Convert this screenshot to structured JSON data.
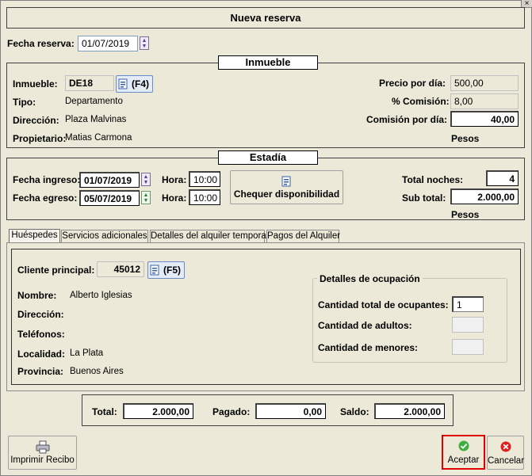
{
  "window": {
    "title": "Nueva reserva",
    "close_glyph": "×",
    "fecha_reserva_label": "Fecha reserva:",
    "fecha_reserva_value": "01/07/2019"
  },
  "inmueble": {
    "section_title": "Inmueble",
    "inmueble_label": "Inmueble:",
    "inmueble_value": "DE18",
    "pick_label": "(F4)",
    "tipo_label": "Tipo:",
    "tipo_value": "Departamento",
    "direccion_label": "Dirección:",
    "direccion_value": "Plaza Malvinas",
    "propietario_label": "Propietario:",
    "propietario_value": "Matias Carmona",
    "precio_label": "Precio por día:",
    "precio_value": "500,00",
    "comision_pct_label": "% Comisión:",
    "comision_pct_value": "8,00",
    "comision_dia_label": "Comisión por día:",
    "comision_dia_value": "40,00",
    "pesos_label": "Pesos"
  },
  "estadia": {
    "section_title": "Estadía",
    "ingreso_label": "Fecha ingreso:",
    "ingreso_value": "01/07/2019",
    "egreso_label": "Fecha egreso:",
    "egreso_value": "05/07/2019",
    "hora_label": "Hora:",
    "hora_ingreso": "10:00",
    "hora_egreso": "10:00",
    "chequear_label": "Chequer disponibilidad",
    "total_noches_label": "Total noches:",
    "total_noches_value": "4",
    "subtotal_label": "Sub total:",
    "subtotal_value": "2.000,00",
    "pesos_label": "Pesos"
  },
  "tabs": [
    {
      "label": "Huéspedes",
      "active": true
    },
    {
      "label": "Servicios adicionales",
      "active": false
    },
    {
      "label": "Detalles del alquiler temporal",
      "active": false
    },
    {
      "label": "Pagos del Alquiler",
      "active": false
    }
  ],
  "huespedes": {
    "cliente_label": "Cliente principal:",
    "cliente_value": "45012",
    "pick_label": "(F5)",
    "nombre_label": "Nombre:",
    "nombre_value": "Alberto Iglesias",
    "direccion_label": "Dirección:",
    "direccion_value": "",
    "telefonos_label": "Teléfonos:",
    "telefonos_value": "",
    "localidad_label": "Localidad:",
    "localidad_value": "La Plata",
    "provincia_label": "Provincia:",
    "provincia_value": "Buenos Aires",
    "ocupacion": {
      "title": "Detalles de ocupación",
      "total_label": "Cantidad total de ocupantes:",
      "total_value": "1",
      "adultos_label": "Cantidad de adultos:",
      "adultos_value": "",
      "menores_label": "Cantidad de menores:",
      "menores_value": ""
    }
  },
  "totales": {
    "total_label": "Total:",
    "total_value": "2.000,00",
    "pagado_label": "Pagado:",
    "pagado_value": "0,00",
    "saldo_label": "Saldo:",
    "saldo_value": "2.000,00"
  },
  "footer": {
    "imprimir_label": "Imprimir Recibo",
    "aceptar_label": "Aceptar",
    "cancelar_label": "Cancelar"
  },
  "colors": {
    "accept_icon": "#3fae3f",
    "cancel_icon": "#e02020",
    "highlight_frame": "#e00000"
  }
}
